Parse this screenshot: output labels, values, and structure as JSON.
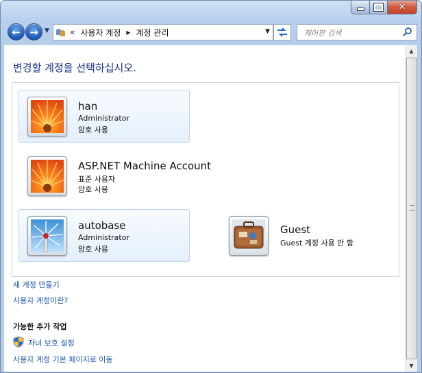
{
  "window": {
    "caption_buttons": [
      "minimize",
      "maximize",
      "close"
    ],
    "close_glyph": "✕"
  },
  "nav": {
    "back_glyph": "←",
    "forward_glyph": "→",
    "breadcrumb_prefix": "«",
    "breadcrumb": [
      "사용자 계정",
      "계정 관리"
    ],
    "refresh_glyph": "↹",
    "search_placeholder": "제어판 검색"
  },
  "main": {
    "heading": "변경할 계정을 선택하십시오.",
    "accounts": [
      {
        "name": "han",
        "type": "Administrator",
        "status": "암호 사용",
        "picture": "flower-orange",
        "highlighted": true
      },
      {
        "name": "ASP.NET Machine Account",
        "type": "표준 사용자",
        "status": "암호 사용",
        "picture": "flower-orange",
        "highlighted": false
      },
      {
        "name": "autobase",
        "type": "Administrator",
        "status": "암호 사용",
        "picture": "windmill",
        "highlighted": true
      },
      {
        "name": "Guest",
        "type": "Guest 계정 사용 안 함",
        "status": "",
        "picture": "suitcase",
        "highlighted": false
      }
    ],
    "links": {
      "create_account": "새 계정 만들기",
      "what_is_account": "사용자 계정이란?"
    },
    "additional_tasks": {
      "title": "가능한 추가 작업",
      "parental_controls": "자녀 보호 설정",
      "goto_main": "사용자 계정 기본 페이지로 이동"
    }
  },
  "colors": {
    "heading": "#1e3287",
    "link": "#1a56b2",
    "highlight_bg": "#e4effb",
    "chrome": "#b9d1ea"
  }
}
